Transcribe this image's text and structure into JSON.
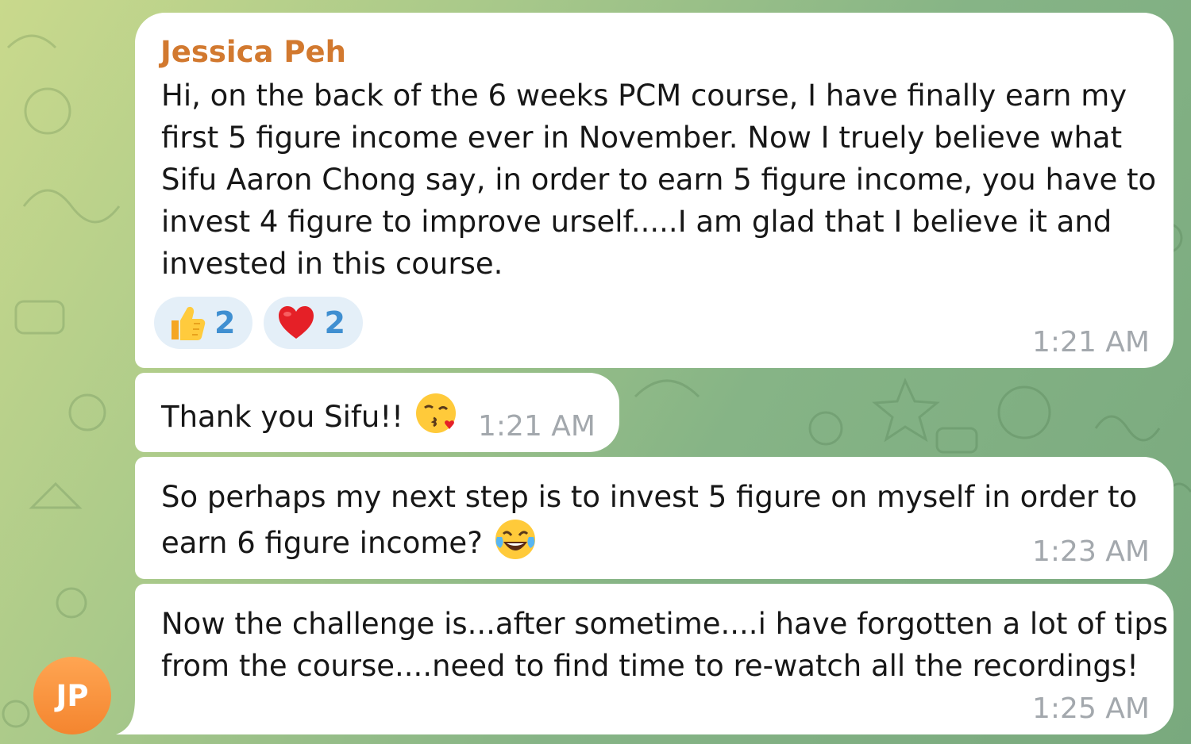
{
  "chat": {
    "sender_name": "Jessica Peh",
    "avatar_initials": "JP",
    "messages": [
      {
        "lines": [
          "Hi, on the back of the 6 weeks PCM course, I have finally earn my",
          "first 5 figure income ever in November. Now I truely believe what",
          "Sifu Aaron Chong say, in order to earn 5 figure income, you have to",
          "invest 4 figure to improve urself.....I am glad that I believe it and",
          "invested in this course."
        ],
        "time": "1:21 AM",
        "reactions": [
          {
            "emoji": "thumbs-up-icon",
            "count": "2"
          },
          {
            "emoji": "red-heart-icon",
            "count": "2"
          }
        ]
      },
      {
        "text": "Thank you Sifu!!",
        "emoji": "face-blowing-kiss-icon",
        "time": "1:21 AM"
      },
      {
        "lines": [
          "So perhaps my next step is to invest 5 figure on myself in order to",
          "earn 6 figure income?"
        ],
        "emoji": "tears-of-joy-icon",
        "time": "1:23 AM"
      },
      {
        "lines": [
          "Now the challenge is...after sometime....i have forgotten a lot of tips",
          "from the course....need to find time to re-watch all the recordings!"
        ],
        "time": "1:25 AM"
      }
    ]
  },
  "colors": {
    "sender_name": "#d2792f",
    "reaction_count": "#3f8fd1",
    "reaction_bg": "#e4eff8",
    "timestamp": "#a3a8ad",
    "avatar": "#f4852f"
  }
}
